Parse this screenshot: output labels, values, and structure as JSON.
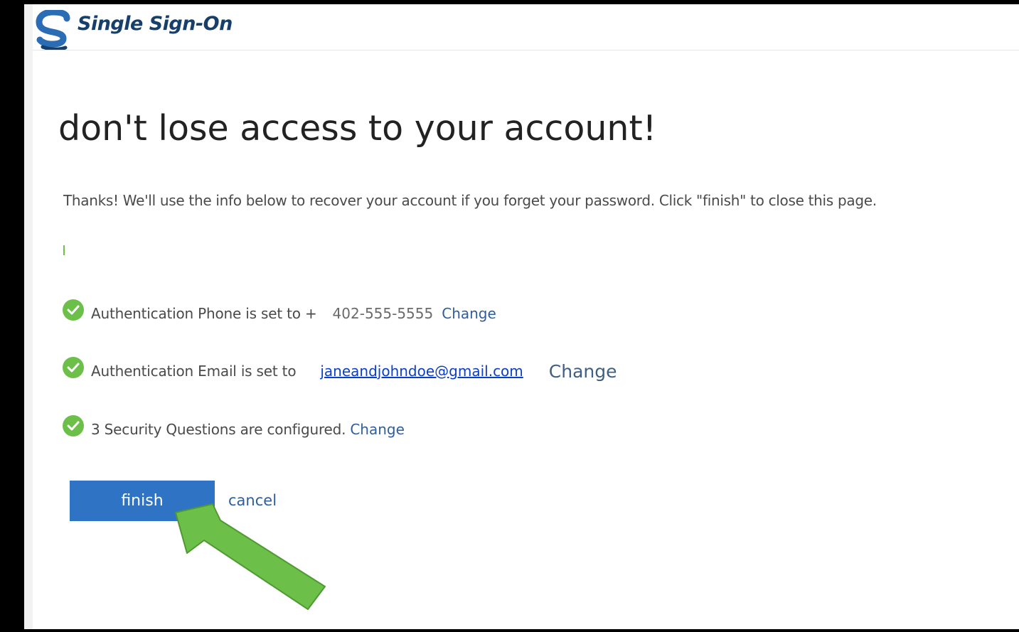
{
  "header": {
    "app_title": "Single Sign-On",
    "brand_color": "#173f6b"
  },
  "main": {
    "title": "don't lose access to your account!",
    "intro": "Thanks! We'll use the info below to recover your account if you forget your password. Click \"finish\" to close this page.",
    "rows": [
      {
        "icon": "check-circle-icon",
        "text": "Authentication Phone is set to +",
        "value": "402-555-5555",
        "link": "Change"
      },
      {
        "icon": "check-circle-icon",
        "text": "Authentication Email is set to",
        "value": "janeandjohndoe@gmail.com",
        "link": "Change"
      },
      {
        "icon": "check-circle-icon",
        "text": "3 Security Questions are configured.",
        "link": "Change"
      }
    ],
    "buttons": {
      "finish": "finish",
      "cancel": "cancel"
    }
  },
  "annotation": {
    "icon": "arrow-icon",
    "color": "#6cc04a"
  },
  "colors": {
    "primary_button": "#2f73c5",
    "success": "#6cc04a",
    "link": "#2e5f9c"
  }
}
